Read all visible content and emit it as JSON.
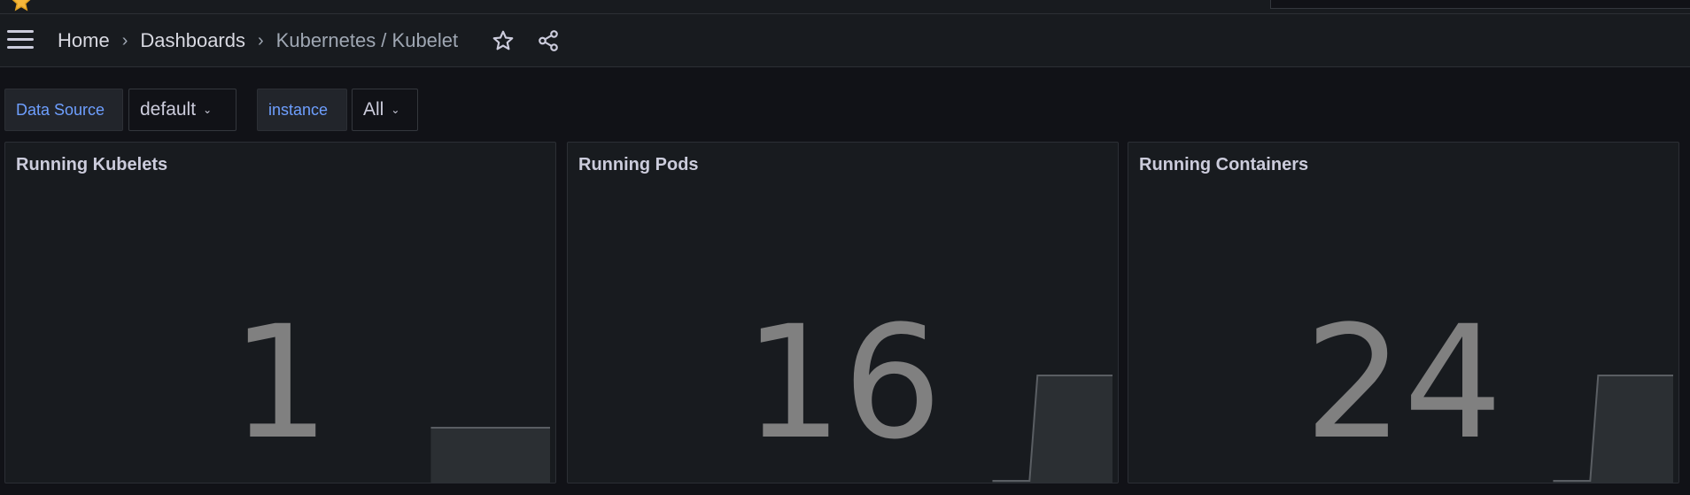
{
  "nav": {
    "breadcrumbs": [
      "Home",
      "Dashboards",
      "Kubernetes / Kubelet"
    ],
    "separator": "›"
  },
  "variables": [
    {
      "label": "Data Source",
      "value": "default"
    },
    {
      "label": "instance",
      "value": "All"
    }
  ],
  "panels": [
    {
      "title": "Running Kubelets",
      "value": "1"
    },
    {
      "title": "Running Pods",
      "value": "16"
    },
    {
      "title": "Running Containers",
      "value": "24"
    }
  ],
  "icons": {
    "menu": "hamburger-menu-icon",
    "star": "star-icon",
    "share": "share-icon",
    "chevron": "chevron-down-icon"
  },
  "colors": {
    "accent_label": "#6e9fff",
    "stat_value": "#808080",
    "background": "#111217",
    "panel": "#181b1f"
  }
}
